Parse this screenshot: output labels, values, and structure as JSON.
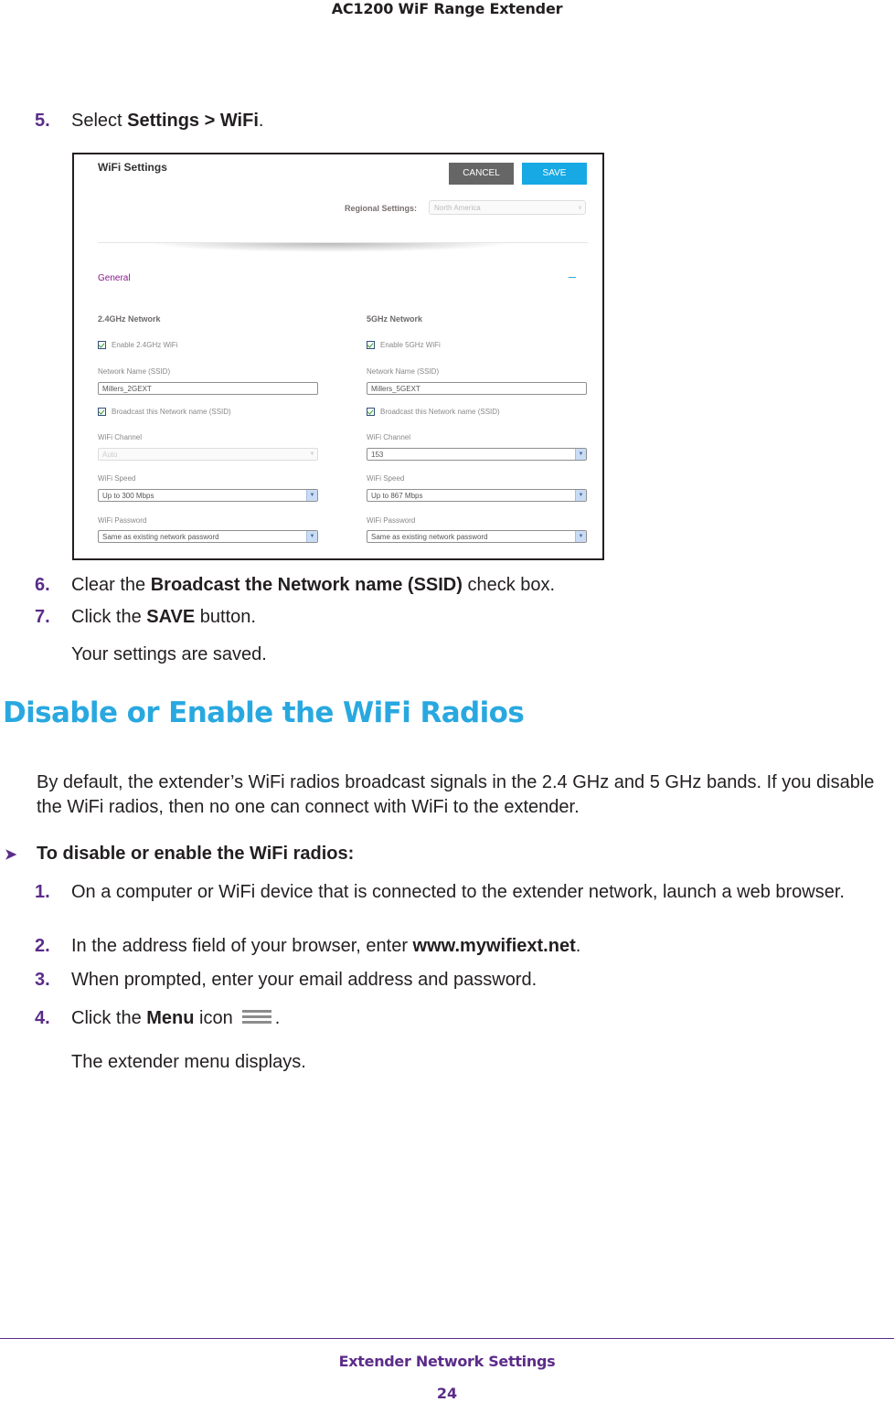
{
  "header": {
    "title": "AC1200 WiF Range Extender"
  },
  "steps_top": [
    {
      "num": "5.",
      "pre": "Select ",
      "bold": "Settings > WiFi",
      "post": "."
    }
  ],
  "screenshot": {
    "title": "WiFi Settings",
    "cancel_label": "CANCEL",
    "save_label": "SAVE",
    "regional_label": "Regional Settings:",
    "regional_value": "North America",
    "general_label": "General",
    "networks": [
      {
        "title": "2.4GHz Network",
        "enable_label": "Enable 2.4GHz WiFi",
        "enable_checked": true,
        "ssid_label": "Network Name (SSID)",
        "ssid_value": "Millers_2GEXT",
        "broadcast_label": "Broadcast this Network name (SSID)",
        "broadcast_checked": true,
        "channel_label": "WiFi Channel",
        "channel_value": "Auto",
        "channel_disabled": true,
        "speed_label": "WiFi Speed",
        "speed_value": "Up to 300 Mbps",
        "password_label": "WiFi Password",
        "password_value": "Same as existing network password"
      },
      {
        "title": "5GHz Network",
        "enable_label": "Enable 5GHz WiFi",
        "enable_checked": true,
        "ssid_label": "Network Name (SSID)",
        "ssid_value": "Millers_5GEXT",
        "broadcast_label": "Broadcast this Network name (SSID)",
        "broadcast_checked": true,
        "channel_label": "WiFi Channel",
        "channel_value": "153",
        "channel_disabled": false,
        "speed_label": "WiFi Speed",
        "speed_value": "Up to 867 Mbps",
        "password_label": "WiFi Password",
        "password_value": "Same as existing network password"
      }
    ]
  },
  "steps_after": [
    {
      "num": "6.",
      "pre": "Clear the ",
      "bold": "Broadcast the Network name (SSID)",
      "post": " check box."
    },
    {
      "num": "7.",
      "pre": "Click the ",
      "bold": "SAVE",
      "post": " button."
    }
  ],
  "result_saved": "Your settings are saved.",
  "section": {
    "title": "Disable or Enable the WiFi Radios",
    "intro": "By default, the extender’s WiFi radios broadcast signals in the 2.4 GHz and 5 GHz bands. If you disable the WiFi radios, then no one can connect with WiFi to the extender.",
    "procedure_title": "To disable or enable the WiFi radios:",
    "steps": [
      {
        "num": "1.",
        "pre": "On a computer or WiFi device that is connected to the extender network, launch a web browser.",
        "bold": "",
        "post": ""
      },
      {
        "num": "2.",
        "pre": "In the address field of your browser, enter ",
        "bold": "www.mywifiext.net",
        "post": "."
      },
      {
        "num": "3.",
        "pre": "When prompted, enter your email address and password.",
        "bold": "",
        "post": ""
      },
      {
        "num": "4.",
        "pre": "Click the ",
        "bold": "Menu",
        "post": " icon"
      }
    ],
    "step4_end": ".",
    "menu_result": "The extender menu displays."
  },
  "footer": {
    "chapter": "Extender Network Settings",
    "page": "24"
  },
  "colors": {
    "accent_purple": "#5b2c8a",
    "heading_blue": "#29a8e0",
    "save_blue": "#16a9e4",
    "cancel_gray": "#666666"
  }
}
